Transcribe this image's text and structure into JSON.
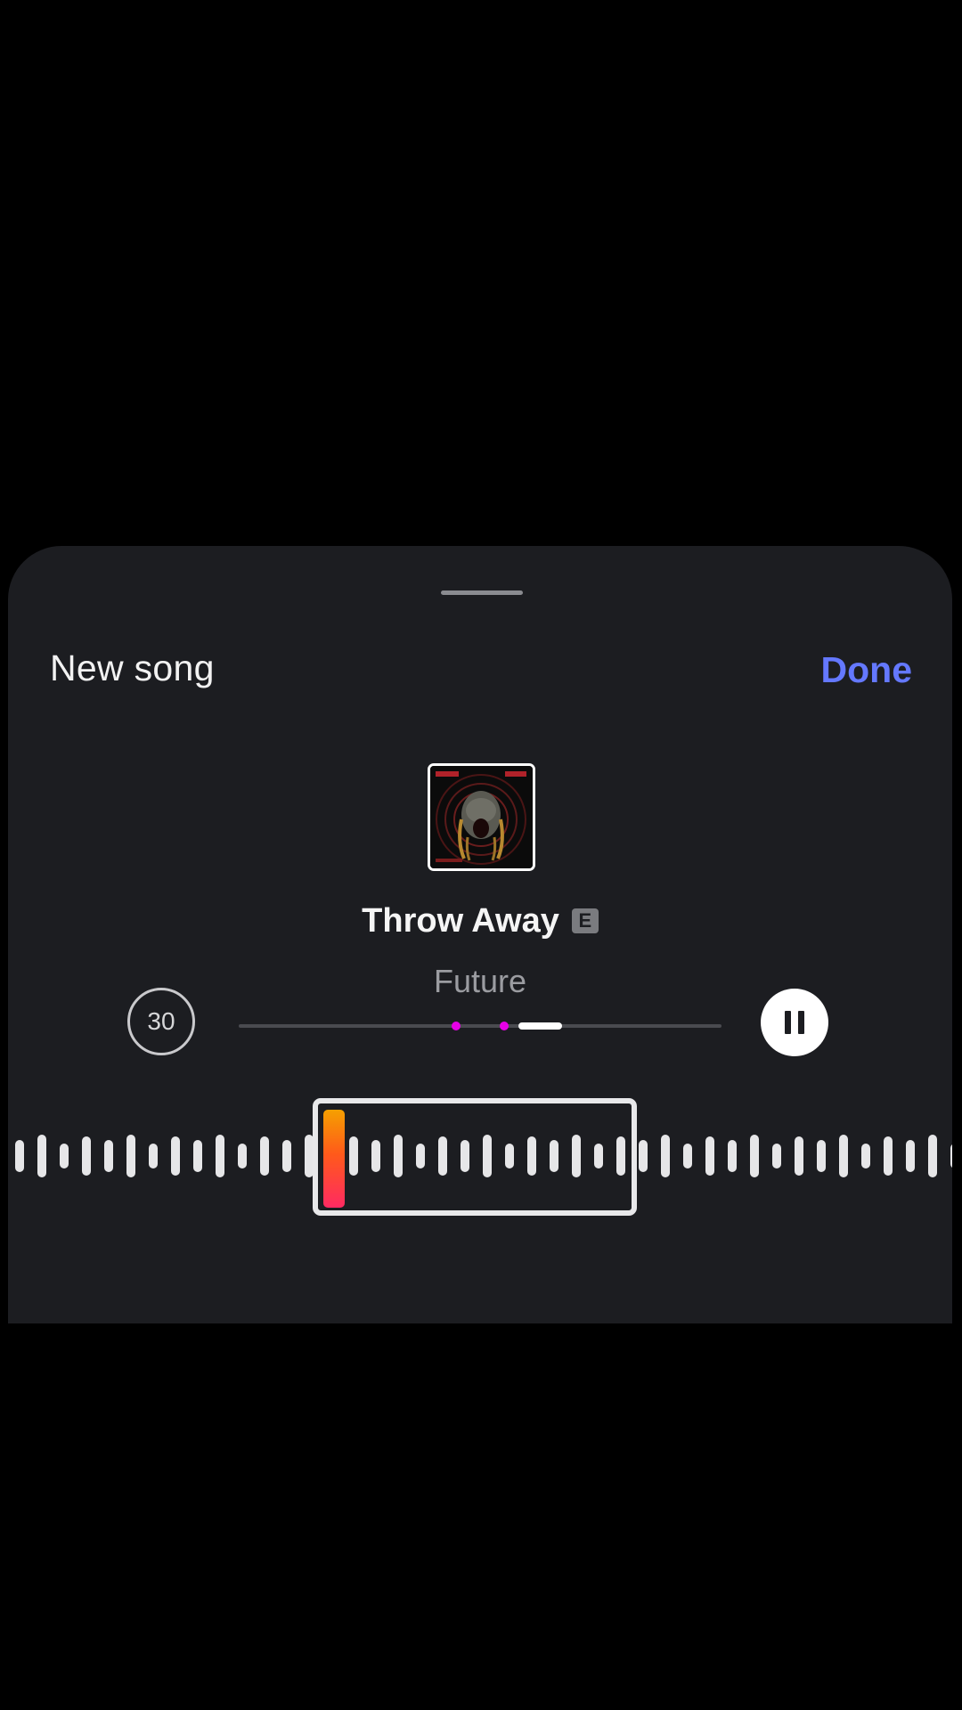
{
  "header": {
    "title": "New song",
    "done_label": "Done"
  },
  "track": {
    "title": "Throw Away",
    "explicit_badge": "E",
    "artist": "Future",
    "duration_label": "30",
    "cover_icon": "album-art"
  },
  "player": {
    "state": "playing",
    "control_icon": "pause-icon",
    "segment_start_fraction": 0.58,
    "segment_end_fraction": 0.67,
    "marker_fractions": [
      0.45,
      0.55
    ]
  },
  "colors": {
    "sheet_background": "#1c1d21",
    "accent": "#6478ff",
    "marker": "#e600e6",
    "playhead_top": "#f5a000",
    "playhead_bottom": "#ff2a62"
  }
}
